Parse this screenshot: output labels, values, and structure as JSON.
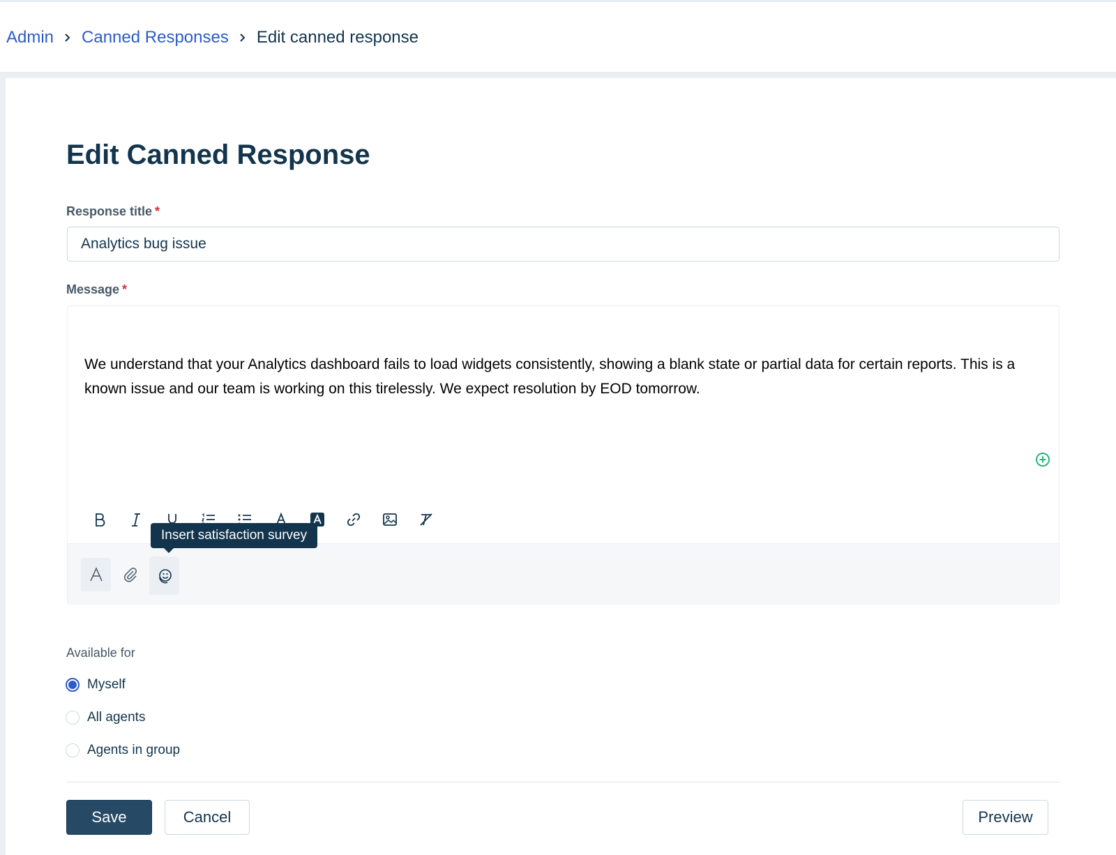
{
  "breadcrumb": {
    "items": [
      "Admin",
      "Canned Responses"
    ],
    "current": "Edit canned response"
  },
  "page": {
    "title": "Edit Canned Response"
  },
  "form": {
    "title_label": "Response title",
    "title_value": "Analytics bug issue",
    "message_label": "Message",
    "required_mark": "*",
    "message_text": "We understand that your Analytics dashboard fails to load widgets consistently, showing a blank state or partial data for certain reports. This is a known issue and our team is working on this tirelessly. We expect resolution by EOD tomorrow."
  },
  "editor": {
    "toolbar": [
      "bold-icon",
      "italic-icon",
      "underline-icon",
      "ordered-list-icon",
      "bullet-list-icon",
      "font-color-icon",
      "background-color-icon",
      "link-icon",
      "image-icon",
      "clear-format-icon"
    ],
    "footer_buttons": [
      "text-format-icon",
      "attachment-icon",
      "satisfaction-survey-icon"
    ],
    "tooltip": "Insert satisfaction survey",
    "add_icon": "plus-circle-icon"
  },
  "availability": {
    "label": "Available for",
    "options": [
      "Myself",
      "All agents",
      "Agents in group"
    ],
    "selected": "Myself"
  },
  "actions": {
    "save": "Save",
    "cancel": "Cancel",
    "preview": "Preview"
  },
  "colors": {
    "link": "#2c5cc5",
    "primary_button": "#264966",
    "text": "#12344d",
    "required": "#d72d30",
    "success": "#27b47a"
  }
}
